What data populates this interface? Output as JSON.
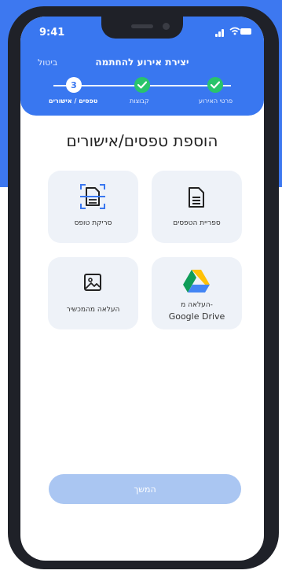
{
  "status_bar": {
    "time": "9:41"
  },
  "header": {
    "cancel_label": "ביטול",
    "title": "יצירת אירוע להחתמה"
  },
  "steps": [
    {
      "label": "פרטי האירוע",
      "state": "done"
    },
    {
      "label": "קבוצות",
      "state": "done"
    },
    {
      "label": "טפסים / אישורים",
      "state": "current",
      "number": "3"
    }
  ],
  "page": {
    "title": "הוספת טפסים/אישורים"
  },
  "options": [
    {
      "label": "ספריית הטפסים",
      "icon": "document-icon"
    },
    {
      "label": "סריקת טופס",
      "icon": "scan-document-icon"
    },
    {
      "label_line1": "העלאה מ-",
      "label_line2": "Google Drive",
      "icon": "google-drive-icon"
    },
    {
      "label": "העלאה מהמכשיר",
      "icon": "image-icon"
    }
  ],
  "continue_label": "המשך",
  "colors": {
    "primary": "#3977f0",
    "step_done": "#29c46b",
    "card_bg": "#eef2f8",
    "button_disabled": "#aac6f2"
  }
}
